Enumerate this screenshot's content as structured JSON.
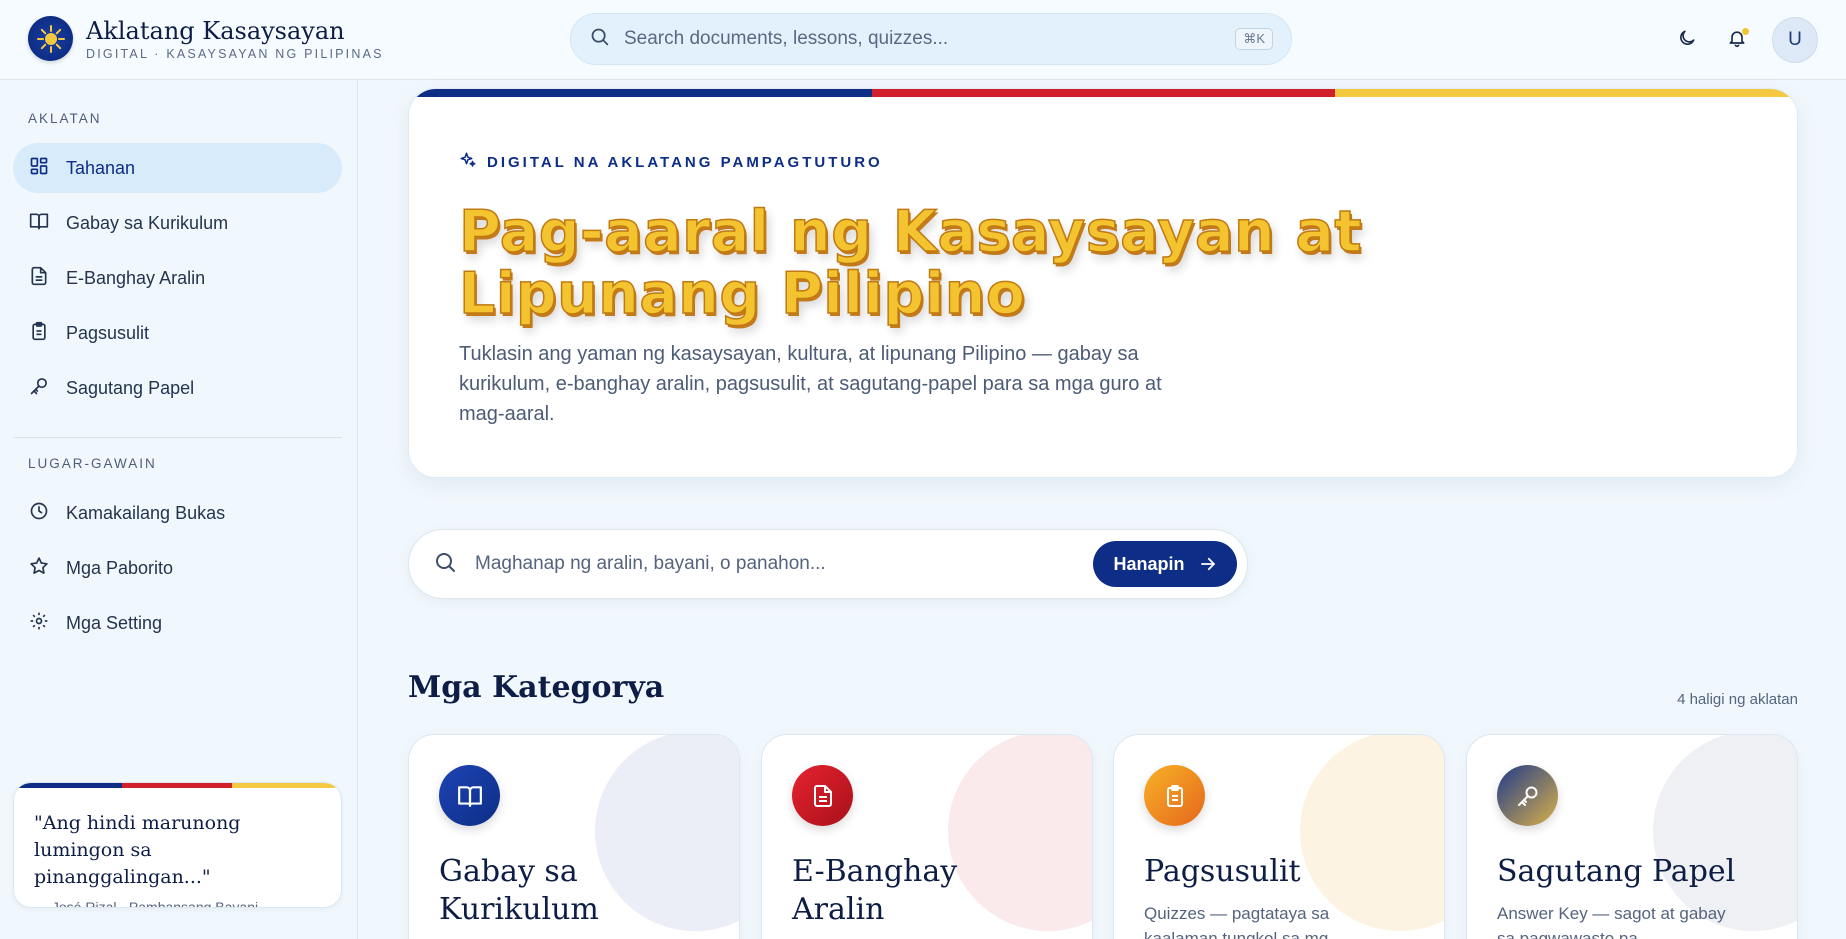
{
  "brand": {
    "title": "Aklatang Kasaysayan",
    "subtitle": "DIGITAL · KASAYSAYAN NG PILIPINAS"
  },
  "top_search": {
    "placeholder": "Search documents, lessons, quizzes...",
    "shortcut": "⌘K"
  },
  "user": {
    "avatar_initial": "U",
    "has_notification": true
  },
  "sidebar": {
    "section_library": "AKLATAN",
    "library_items": [
      {
        "label": "Tahanan",
        "icon": "grid-icon",
        "active": true
      },
      {
        "label": "Gabay sa Kurikulum",
        "icon": "book-icon",
        "active": false
      },
      {
        "label": "E-Banghay Aralin",
        "icon": "document-icon",
        "active": false
      },
      {
        "label": "Pagsusulit",
        "icon": "clipboard-icon",
        "active": false
      },
      {
        "label": "Sagutang Papel",
        "icon": "key-icon",
        "active": false
      }
    ],
    "section_workspace": "LUGAR-GAWAIN",
    "workspace_items": [
      {
        "label": "Kamakailang Bukas",
        "icon": "clock-icon"
      },
      {
        "label": "Mga Paborito",
        "icon": "star-icon"
      },
      {
        "label": "Mga Setting",
        "icon": "gear-icon"
      }
    ],
    "quote": {
      "text": "\"Ang hindi marunong lumingon sa pinanggalingan...\"",
      "author": "— José Rizal · Pambansang Bayani"
    }
  },
  "hero": {
    "kicker": "DIGITAL NA AKLATANG PAMPAGTUTURO",
    "title": "Pag-aaral ng Kasaysayan at Lipunang Pilipino",
    "description": "Tuklasin ang yaman ng kasaysayan, kultura, at lipunang Pilipino — gabay sa kurikulum, e-banghay aralin, pagsusulit, at sagutang-papel para sa mga guro at mag-aaral."
  },
  "main_search": {
    "placeholder": "Maghanap ng aralin, bayani, o panahon...",
    "button_label": "Hanapin"
  },
  "categories": {
    "heading": "Mga Kategorya",
    "count_label": "4 haligi ng aklatan",
    "items": [
      {
        "title": "Gabay sa Kurikulum",
        "description": "",
        "icon": "book-icon",
        "color": "#0d2d86",
        "blob": "#eceef7"
      },
      {
        "title": "E-Banghay Aralin",
        "description": "",
        "icon": "document-icon",
        "color": "#c8141f",
        "blob": "#fbeaec"
      },
      {
        "title": "Pagsusulit",
        "description": "Quizzes — pagtataya sa kaalaman tungkol sa mg...",
        "icon": "clipboard-icon",
        "color": "#f0941f",
        "blob": "#fdf3e2"
      },
      {
        "title": "Sagutang Papel",
        "description": "Answer Key — sagot at gabay sa pagwawasto pa...",
        "icon": "key-icon",
        "color": "#2c4a8a",
        "blob": "#eff0f3"
      }
    ]
  },
  "colors": {
    "navy": "#0d2d86",
    "red": "#d21f2c",
    "yellow": "#f5c842"
  }
}
